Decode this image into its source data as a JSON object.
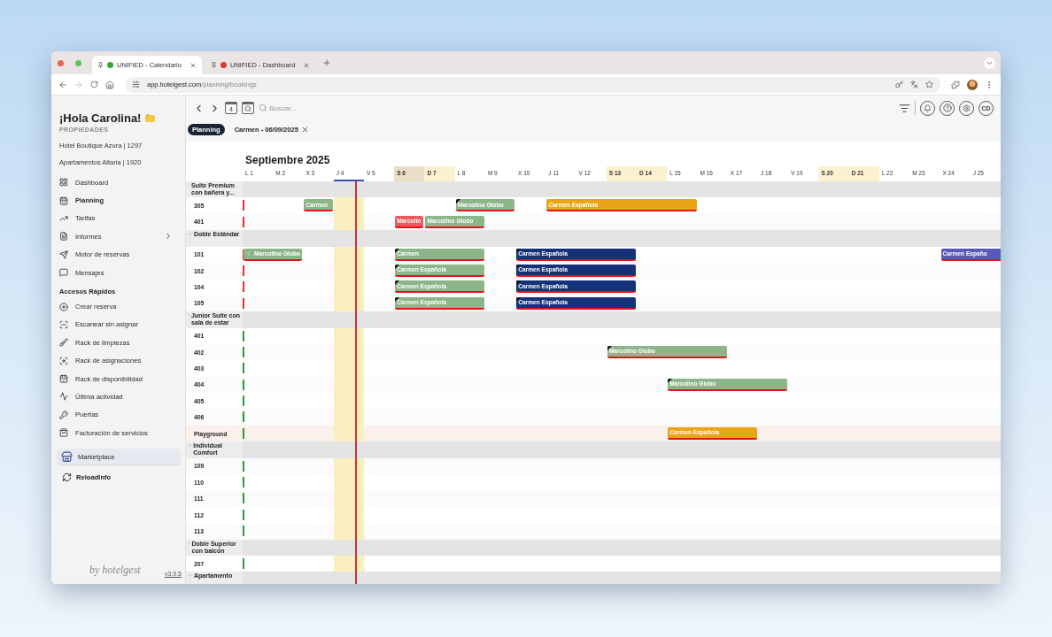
{
  "browser": {
    "tabs": [
      {
        "title": "UNIFIED - Calendario",
        "selected": true,
        "color": "#3aa63a"
      },
      {
        "title": "UNIFIED - Dashboard",
        "selected": false,
        "color": "#d83a32"
      }
    ],
    "url_domain": "app.hotelgest.com",
    "url_path": "/planning/bookings"
  },
  "sidebar": {
    "greeting": "¡Hola Carolina!",
    "properties_label": "PROPIEDADES",
    "properties": [
      "Hotel Boutique Azura | 1297",
      "Apartamentos Altaria | 1920"
    ],
    "menu": [
      {
        "label": "Dashboard",
        "selected": false,
        "submenu": false
      },
      {
        "label": "Planning",
        "selected": true,
        "submenu": false
      },
      {
        "label": "Tarifas",
        "selected": false,
        "submenu": false
      },
      {
        "label": "Informes",
        "selected": false,
        "submenu": true
      },
      {
        "label": "Motor de reservas",
        "selected": false,
        "submenu": false
      },
      {
        "label": "Mensajes",
        "selected": false,
        "submenu": false
      }
    ],
    "quick_access_title": "Accesos Rápidos",
    "quick_access": [
      "Crear reserva",
      "Escanear sin asignar",
      "Rack de limpiezas",
      "Rack de asignaciones",
      "Rack de disponibilidad",
      "Última actividad",
      "Puertas",
      "Facturación de servicios"
    ],
    "marketplace": "Marketplace",
    "reload": "ReloadInfo",
    "brand": "by hotelgest",
    "version": "v3.9.5"
  },
  "toolbar": {
    "calendar_day": "4",
    "search": {
      "placeholder": "Buscar..."
    },
    "avatar": "CD"
  },
  "chips": [
    {
      "label": "Planning",
      "selected": true,
      "closable": false
    },
    {
      "label": "Carmen - 06/09/2025",
      "selected": false,
      "closable": true
    }
  ],
  "calendar": {
    "month": "Septiembre 2025",
    "days": [
      {
        "label": "L 1",
        "weekend": false,
        "today": false,
        "selected": false
      },
      {
        "label": "M 2",
        "weekend": false,
        "today": false,
        "selected": false
      },
      {
        "label": "X 3",
        "weekend": false,
        "today": false,
        "selected": false
      },
      {
        "label": "J 4",
        "weekend": false,
        "today": true,
        "selected": false
      },
      {
        "label": "V 5",
        "weekend": false,
        "today": false,
        "selected": false
      },
      {
        "label": "S 6",
        "weekend": true,
        "today": false,
        "selected": true
      },
      {
        "label": "D 7",
        "weekend": true,
        "today": false,
        "selected": false
      },
      {
        "label": "L 8",
        "weekend": false,
        "today": false,
        "selected": false
      },
      {
        "label": "M 9",
        "weekend": false,
        "today": false,
        "selected": false
      },
      {
        "label": "X 10",
        "weekend": false,
        "today": false,
        "selected": false
      },
      {
        "label": "J 11",
        "weekend": false,
        "today": false,
        "selected": false
      },
      {
        "label": "V 12",
        "weekend": false,
        "today": false,
        "selected": false
      },
      {
        "label": "S 13",
        "weekend": true,
        "today": false,
        "selected": false
      },
      {
        "label": "D 14",
        "weekend": true,
        "today": false,
        "selected": false
      },
      {
        "label": "L 15",
        "weekend": false,
        "today": false,
        "selected": false
      },
      {
        "label": "M 16",
        "weekend": false,
        "today": false,
        "selected": false
      },
      {
        "label": "X 17",
        "weekend": false,
        "today": false,
        "selected": false
      },
      {
        "label": "J 18",
        "weekend": false,
        "today": false,
        "selected": false
      },
      {
        "label": "V 19",
        "weekend": false,
        "today": false,
        "selected": false
      },
      {
        "label": "S 20",
        "weekend": true,
        "today": false,
        "selected": false
      },
      {
        "label": "D 21",
        "weekend": true,
        "today": false,
        "selected": false
      },
      {
        "label": "L 22",
        "weekend": false,
        "today": false,
        "selected": false
      },
      {
        "label": "M 23",
        "weekend": false,
        "today": false,
        "selected": false
      },
      {
        "label": "X 24",
        "weekend": false,
        "today": false,
        "selected": false
      },
      {
        "label": "J 25",
        "weekend": false,
        "today": false,
        "selected": false
      }
    ],
    "groups": [
      {
        "name": "Suite Premium con bañera y...",
        "rooms": [
          {
            "name": "305",
            "color": "#e0342c",
            "shaded": false,
            "bookings": [
              {
                "guest": "Carmen",
                "color": "#8db58a",
                "marked": false,
                "continued": false
              },
              {
                "guest": "Marcolino Globo",
                "color": "#8db58a",
                "marked": true,
                "continued": false
              },
              {
                "guest": "Carmen Española",
                "color": "#e9a515",
                "marked": false,
                "continued": false
              }
            ]
          },
          {
            "name": "401",
            "color": "#e0342c",
            "shaded": false,
            "bookings": [
              {
                "guest": "Marcolin",
                "color": "#ea5a5c",
                "marked": false,
                "continued": false
              },
              {
                "guest": "Marcolino Globo",
                "color": "#8db58a",
                "marked": false,
                "continued": false
              }
            ]
          }
        ]
      },
      {
        "name": "Doble Estándar",
        "rooms": [
          {
            "name": "101",
            "color": "#e0342c",
            "shaded": false,
            "bookings": [
              {
                "guest": "Marcolino Globo",
                "color": "#8db58a",
                "marked": false,
                "continued": true
              },
              {
                "guest": "Carmen",
                "color": "#8db58a",
                "marked": true,
                "continued": false
              },
              {
                "guest": "Carmen Española",
                "color": "#14317a",
                "marked": true,
                "continued": false
              },
              {
                "guest": "Carmen Españo",
                "color": "#5a58b8",
                "marked": false,
                "continued": false
              }
            ]
          },
          {
            "name": "102",
            "color": "#e0342c",
            "shaded": false,
            "bookings": [
              {
                "guest": "Carmen Española",
                "color": "#8db58a",
                "marked": true,
                "continued": false
              },
              {
                "guest": "Carmen Española",
                "color": "#14317a",
                "marked": true,
                "continued": false
              }
            ]
          },
          {
            "name": "104",
            "color": "#e0342c",
            "shaded": false,
            "bookings": [
              {
                "guest": "Carmen Española",
                "color": "#8db58a",
                "marked": true,
                "continued": false
              },
              {
                "guest": "Carmen Española",
                "color": "#14317a",
                "marked": true,
                "continued": false
              }
            ]
          },
          {
            "name": "105",
            "color": "#e0342c",
            "shaded": false,
            "bookings": [
              {
                "guest": "Carmen Española",
                "color": "#8db58a",
                "marked": true,
                "continued": false
              },
              {
                "guest": "Carmen Española",
                "color": "#14317a",
                "marked": true,
                "continued": false
              }
            ]
          }
        ]
      },
      {
        "name": "Junior Suite con sala de estar",
        "rooms": [
          {
            "name": "401",
            "color": "#2f9a3a",
            "shaded": false
          },
          {
            "name": "402",
            "color": "#2f9a3a",
            "shaded": false,
            "bookings": [
              {
                "guest": "Marcolino Globo",
                "color": "#8db58a",
                "marked": true,
                "continued": false
              }
            ]
          },
          {
            "name": "403",
            "color": "#2f9a3a",
            "shaded": false
          },
          {
            "name": "404",
            "color": "#2f9a3a",
            "shaded": false,
            "bookings": [
              {
                "guest": "Marcolino Globo",
                "color": "#8db58a",
                "marked": true,
                "continued": false
              }
            ]
          },
          {
            "name": "405",
            "color": "#2f9a3a",
            "shaded": false
          },
          {
            "name": "406",
            "color": "#2f9a3a",
            "shaded": false
          },
          {
            "name": "Playground",
            "color": "#2f9a3a",
            "shaded": true,
            "bookings": [
              {
                "guest": "Carmen Española",
                "color": "#e9a515",
                "marked": false,
                "continued": false
              }
            ]
          }
        ]
      },
      {
        "name": "Individual Comfort",
        "rooms": [
          {
            "name": "109",
            "color": "#2f9a3a",
            "shaded": false
          },
          {
            "name": "110",
            "color": "#2f9a3a",
            "shaded": false
          },
          {
            "name": "111",
            "color": "#2f9a3a",
            "shaded": false
          },
          {
            "name": "112",
            "color": "#2f9a3a",
            "shaded": false
          },
          {
            "name": "113",
            "color": "#2f9a3a",
            "shaded": false
          }
        ]
      },
      {
        "name": "Doble Superior con balcón",
        "rooms": [
          {
            "name": "207",
            "color": "#2f9a3a",
            "shaded": false
          }
        ]
      },
      {
        "name": "Apartamento"
      }
    ]
  }
}
